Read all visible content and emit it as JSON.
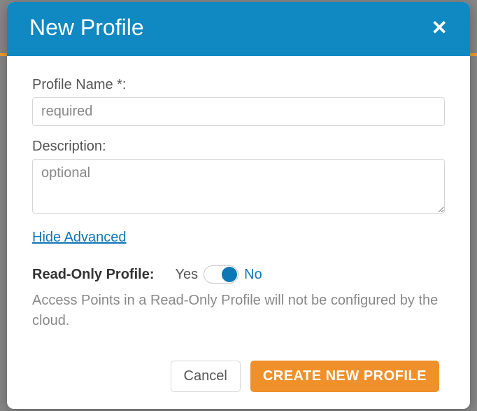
{
  "modal": {
    "title": "New Profile",
    "profileName": {
      "label": "Profile Name *:",
      "placeholder": "required",
      "value": ""
    },
    "description": {
      "label": "Description:",
      "placeholder": "optional",
      "value": ""
    },
    "advancedLink": "Hide Advanced",
    "readOnly": {
      "label": "Read-Only Profile:",
      "yes": "Yes",
      "no": "No",
      "value": "No",
      "help": "Access Points in a Read-Only Profile will not be configured by the cloud."
    },
    "buttons": {
      "cancel": "Cancel",
      "create": "CREATE NEW PROFILE"
    }
  }
}
